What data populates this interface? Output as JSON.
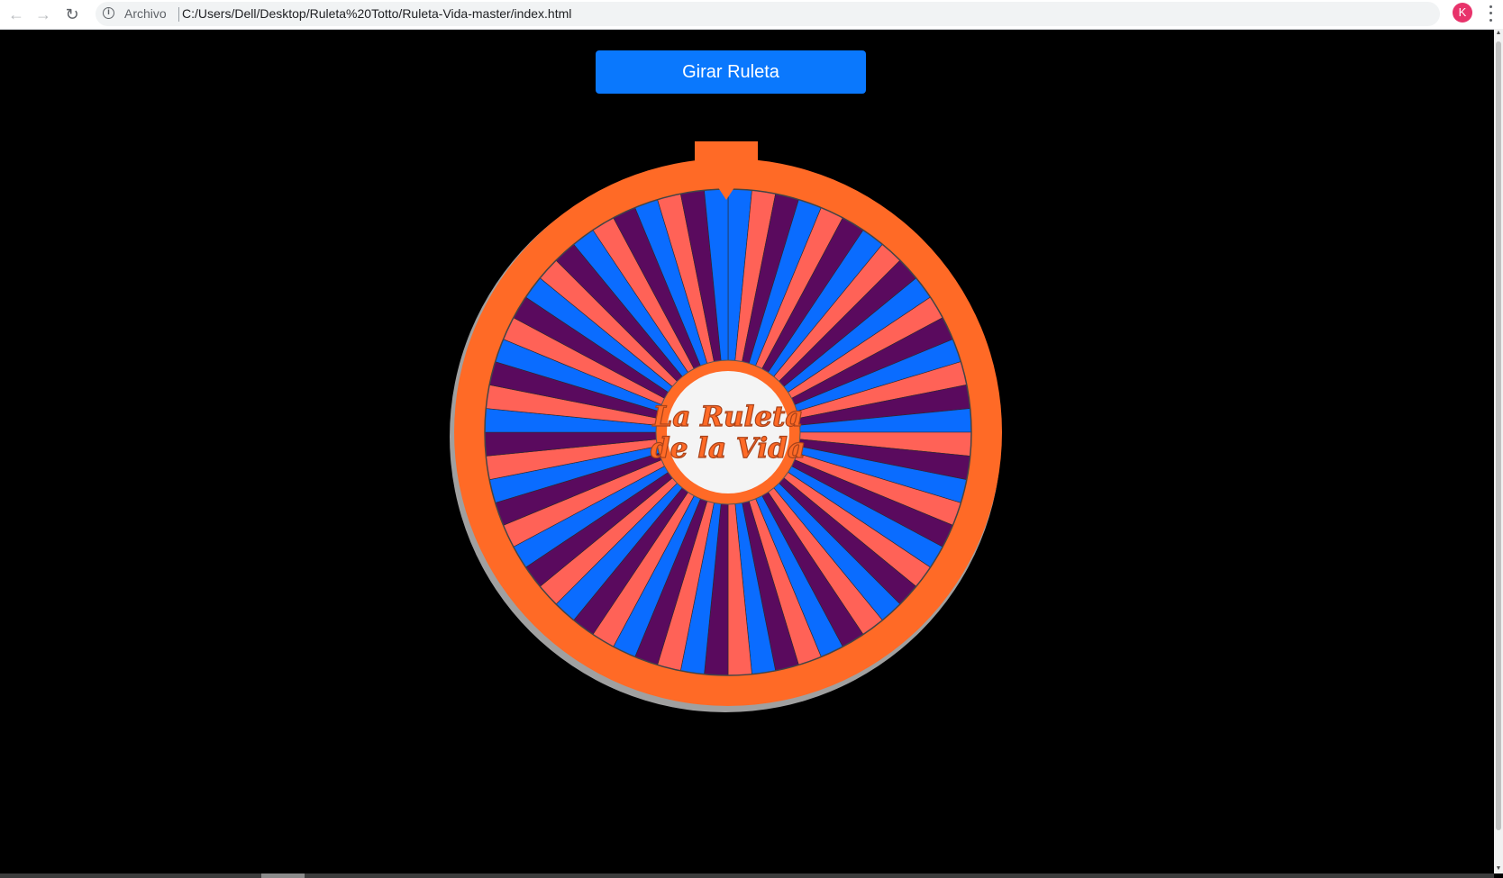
{
  "browser": {
    "security_label": "Archivo",
    "url": "C:/Users/Dell/Desktop/Ruleta%20Totto/Ruleta-Vida-master/index.html",
    "profile_initial": "K",
    "icons": {
      "back": "arrow-left-icon",
      "forward": "arrow-right-icon",
      "reload": "reload-icon",
      "info": "info-icon",
      "bookmark": "star-icon",
      "menu": "kebab-icon"
    }
  },
  "page": {
    "spin_button_label": "Girar Ruleta",
    "background_color": "#000000",
    "button_color": "#0a78fd"
  },
  "wheel": {
    "logo_line1": "La Ruleta",
    "logo_line2": "de la Vida",
    "segment_count": 64,
    "segment_colors": [
      "#0a6cff",
      "#ff6257",
      "#5a0a5e"
    ],
    "rim_color": "#ff6a26",
    "center_color": "#f4f4f4"
  }
}
